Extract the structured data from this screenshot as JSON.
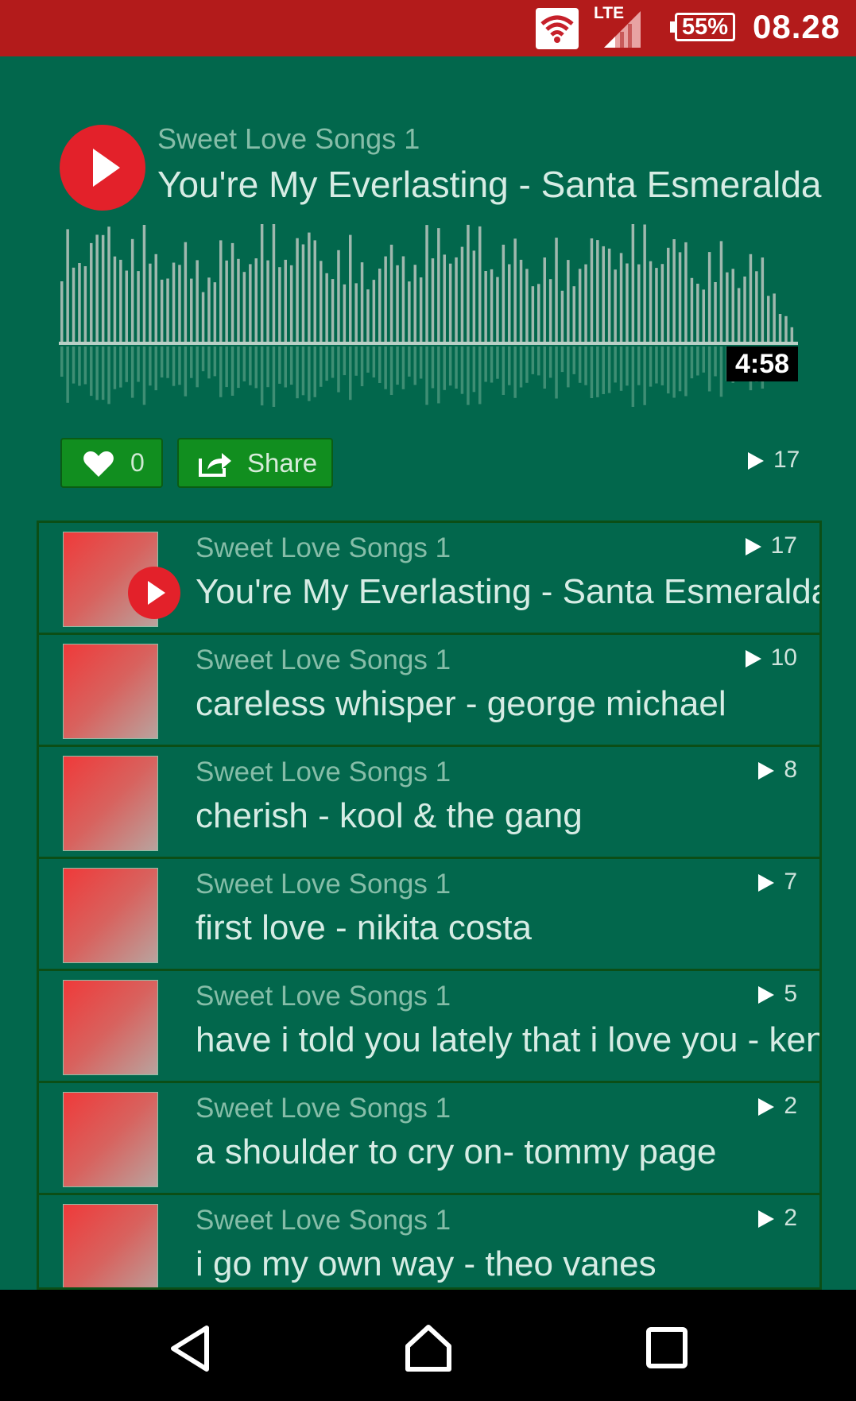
{
  "status_bar": {
    "network": "LTE",
    "battery": "55%",
    "time": "08.28"
  },
  "now_playing": {
    "album": "Sweet Love Songs 1",
    "title": "You're My Everlasting - Santa Esmeralda",
    "duration": "4:58",
    "likes": "0",
    "share_label": "Share",
    "play_count": "17"
  },
  "playlist": [
    {
      "album": "Sweet Love Songs 1",
      "title": "You're My Everlasting - Santa Esmeralda",
      "plays": "17",
      "playing": true
    },
    {
      "album": "Sweet Love Songs 1",
      "title": "careless whisper - george michael",
      "plays": "10"
    },
    {
      "album": "Sweet Love Songs 1",
      "title": "cherish - kool & the gang",
      "plays": "8"
    },
    {
      "album": "Sweet Love Songs 1",
      "title": "first love - nikita costa",
      "plays": "7"
    },
    {
      "album": "Sweet Love Songs 1",
      "title": "have i told you lately that i love you - kenn",
      "plays": "5"
    },
    {
      "album": "Sweet Love Songs 1",
      "title": "a shoulder to cry on- tommy page",
      "plays": "2"
    },
    {
      "album": "Sweet Love Songs 1",
      "title": "i go my own way - theo vanes",
      "plays": "2"
    }
  ],
  "colors": {
    "background": "#02674c",
    "status_bar": "#b31b1b",
    "accent_red": "#e3212a",
    "button_green": "#118e1f"
  },
  "icons": {
    "wifi": "wifi-icon",
    "signal": "signal-icon",
    "play": "play-icon",
    "heart": "heart-icon",
    "share": "share-icon",
    "back": "back-icon",
    "home": "home-icon",
    "recents": "recents-icon"
  }
}
